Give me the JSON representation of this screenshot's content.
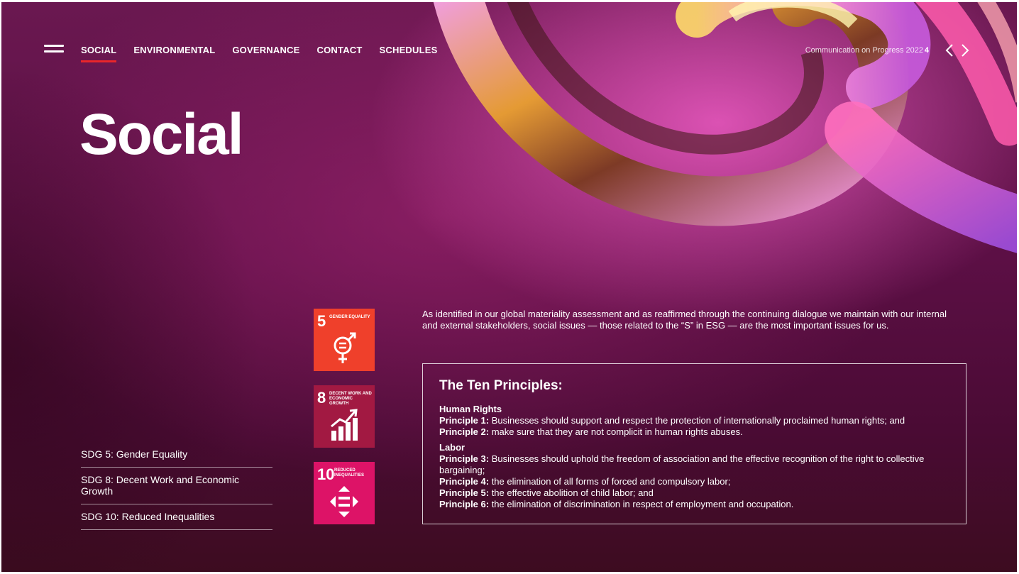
{
  "nav": {
    "items": [
      "SOCIAL",
      "ENVIRONMENTAL",
      "GOVERNANCE",
      "CONTACT",
      "SCHEDULES"
    ]
  },
  "header": {
    "report_title": "Communication on Progress 2022",
    "page_number": "4"
  },
  "page": {
    "title": "Social",
    "intro": "As identified in our global materiality assessment and as reaffirmed through the continuing dialogue we maintain with our internal and external stakeholders, social issues — those related to the “S” in ESG — are the most important issues for us."
  },
  "sdg_tiles": [
    {
      "number": "5",
      "label": "GENDER EQUALITY",
      "color": "#ef402b"
    },
    {
      "number": "8",
      "label": "DECENT WORK AND ECONOMIC GROWTH",
      "color": "#a21942"
    },
    {
      "number": "10",
      "label": "REDUCED INEQUALITIES",
      "color": "#dd1367"
    }
  ],
  "sdg_list": [
    "SDG 5: Gender Equality",
    "SDG 8: Decent Work and Economic Growth",
    "SDG 10: Reduced Inequalities"
  ],
  "principles": {
    "heading": "The Ten Principles:",
    "human_rights": {
      "title": "Human Rights",
      "items": [
        {
          "label": "Principle 1:",
          "text": " Businesses should support and respect the protection of internationally proclaimed human rights; and"
        },
        {
          "label": "Principle 2:",
          "text": " make sure that they are not complicit in human rights abuses."
        }
      ]
    },
    "labor": {
      "title": "Labor",
      "items": [
        {
          "label": "Principle 3:",
          "text": " Businesses should uphold the freedom of association and the effective recognition of the right to collective bargaining;"
        },
        {
          "label": "Principle 4:",
          "text": " the elimination of all forms of forced and compulsory labor;"
        },
        {
          "label": "Principle 5:",
          "text": " the effective abolition of child labor; and"
        },
        {
          "label": "Principle 6:",
          "text": " the elimination of discrimination in respect of employment and occupation."
        }
      ]
    }
  },
  "colors": {
    "accent": "#e8262a",
    "background": "#5c0f45"
  }
}
